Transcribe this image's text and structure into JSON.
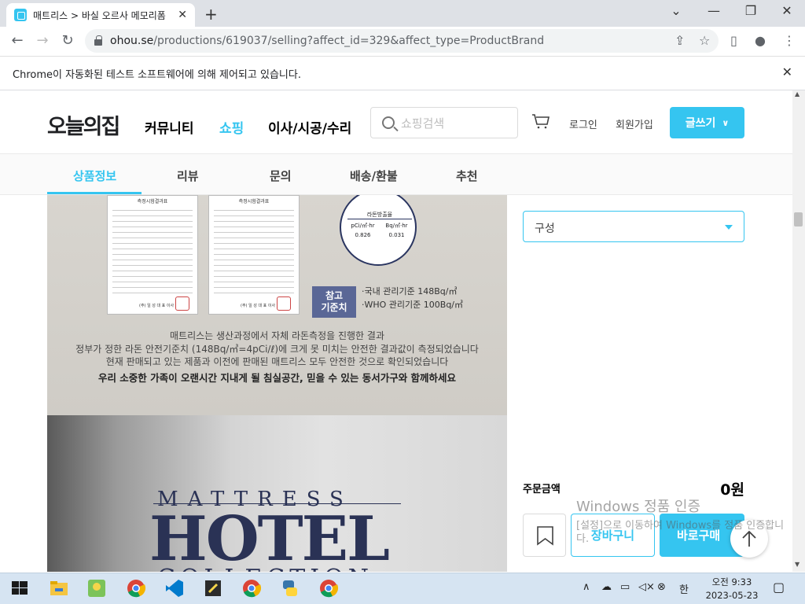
{
  "browser": {
    "tab_title": "매트리스 > 바실 오르사 메모리폼",
    "url_host": "ohou.se",
    "url_path": "/productions/619037/selling?affect_id=329&affect_type=ProductBrand",
    "infobar_text": "Chrome이 자동화된 테스트 소프트웨어에 의해 제어되고 있습니다."
  },
  "header": {
    "logo": "오늘의집",
    "nav": [
      "커뮤니티",
      "쇼핑",
      "이사/시공/수리"
    ],
    "search_placeholder": "쇼핑검색",
    "login": "로그인",
    "signup": "회원가입",
    "write": "글쓰기"
  },
  "subnav": [
    "상품정보",
    "리뷰",
    "문의",
    "배송/환불",
    "추천"
  ],
  "product_image": {
    "doc_title": "측정시험결과표",
    "doc_sig": "(주) 일 성 대 표 이사",
    "radon_header": "라돈방출율",
    "radon_units": [
      "pCi/㎡·hr",
      "Bq/㎡·hr"
    ],
    "radon_values": [
      "0.826",
      "0.031"
    ],
    "ref_label_1": "참고",
    "ref_label_2": "기준치",
    "ref_domestic": "·국내 관리기준 148Bq/㎥",
    "ref_who": "·WHO 관리기준 100Bq/㎥",
    "text_line1": "매트리스는 생산과정에서 자체 라돈측정을 진행한 결과",
    "text_line2": "정부가 정한 라돈 안전기준치 (148Bq/㎥=4pCi/ℓ)에 크게 못 미치는 안전한 결과값이 측정되었습니다",
    "text_line3": "현재 판매되고 있는 제품과 이전에 판매된 매트리스 모두 안전한 것으로 확인되었습니다",
    "text_line4": "우리 소중한 가족이 오랜시간 지내게 될 침실공간, 믿을 수 있는 동서가구와 함께하세요",
    "brand_line1": "MATTRESS",
    "brand_line2": "HOTEL",
    "brand_line3": "COLLECTION"
  },
  "purchase": {
    "option_select": "구성",
    "order_label": "주문금액",
    "order_amount": "0원",
    "cart_button": "장바구니",
    "buy_button": "바로구매"
  },
  "watermark": {
    "line1": "Windows 정품 인증",
    "line2": "[설정]으로 이동하여 Windows를 정품 인증합니다."
  },
  "taskbar": {
    "clock_time": "오전 9:33",
    "clock_date": "2023-05-23",
    "ime": "한"
  },
  "colors": {
    "brand": "#35c5f0",
    "navy": "#2a3255"
  }
}
